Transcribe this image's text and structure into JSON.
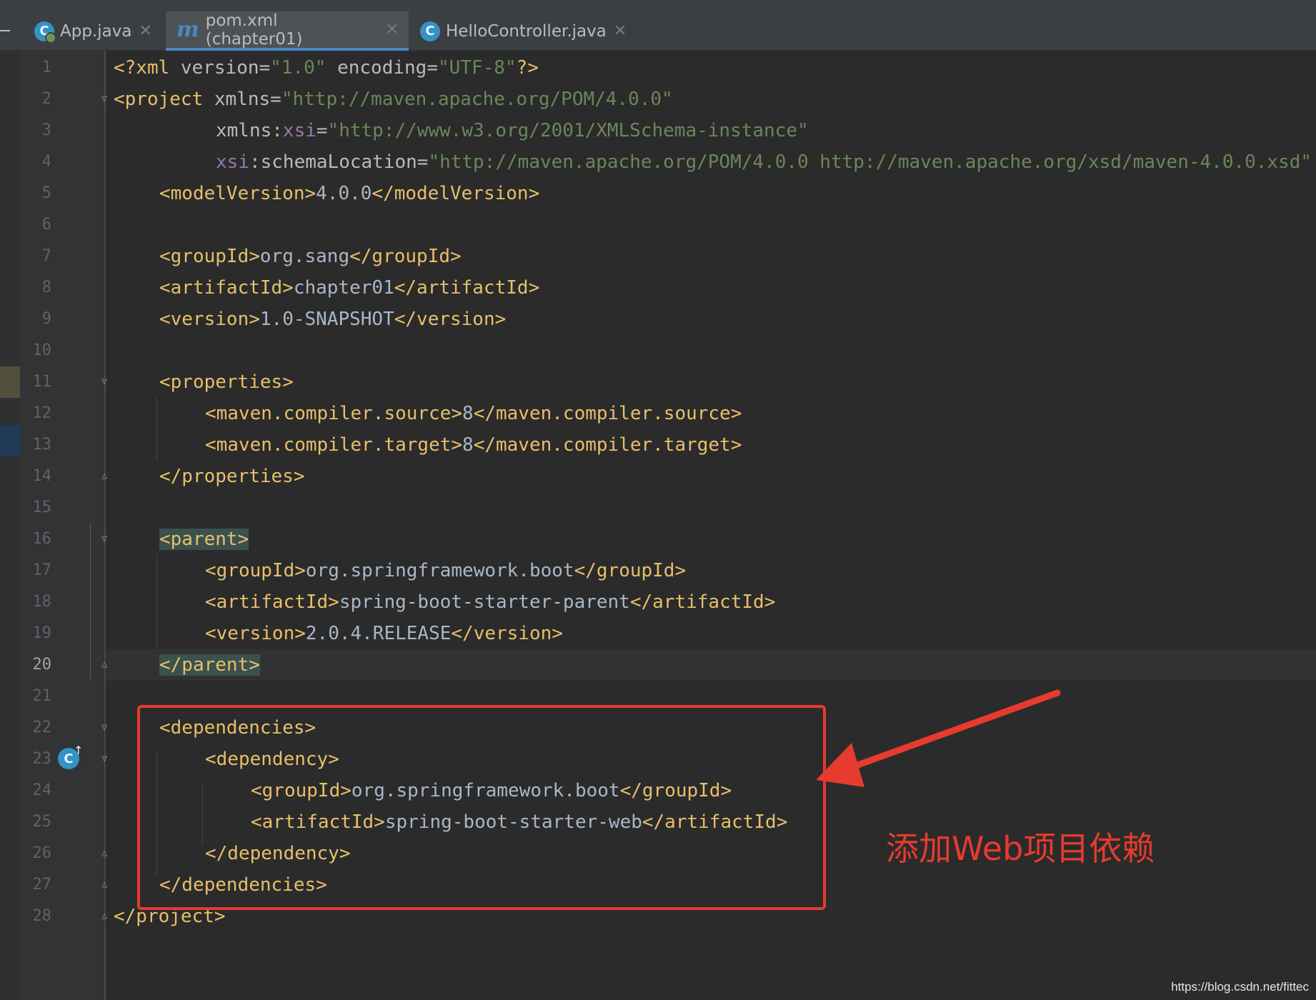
{
  "tabs": [
    {
      "label": "App.java",
      "icon": "spring-class-icon",
      "active": false
    },
    {
      "label": "pom.xml (chapter01)",
      "icon": "maven-icon",
      "active": true
    },
    {
      "label": "HelloController.java",
      "icon": "class-icon",
      "active": false
    }
  ],
  "tab_icon_glyphs": {
    "class": "C",
    "maven": "m"
  },
  "close_glyph": "✕",
  "code": {
    "line_numbers": [
      "1",
      "2",
      "3",
      "4",
      "5",
      "6",
      "7",
      "8",
      "9",
      "10",
      "11",
      "12",
      "13",
      "14",
      "15",
      "16",
      "17",
      "18",
      "19",
      "20",
      "21",
      "22",
      "23",
      "24",
      "25",
      "26",
      "27",
      "28"
    ],
    "current_line": "20",
    "l1": {
      "open": "<?xml ",
      "a1": "version",
      "eq": "=",
      "v1": "\"1.0\"",
      "sp": " ",
      "a2": "encoding",
      "v2": "\"UTF-8\"",
      "close": "?>"
    },
    "l2": {
      "open": "<project ",
      "a1": "xmlns",
      "eq": "=",
      "v1": "\"http://maven.apache.org/POM/4.0.0\""
    },
    "l3": {
      "ns_prefix": "xmlns:",
      "ns": "xsi",
      "eq": "=",
      "v1": "\"http://www.w3.org/2001/XMLSchema-instance\""
    },
    "l4": {
      "ns": "xsi",
      "attr": ":schemaLocation",
      "eq": "=",
      "v1": "\"http://maven.apache.org/POM/4.0.0 http://maven.apache.org/xsd/maven-4.0.0.xsd\""
    },
    "l5": {
      "open": "<modelVersion>",
      "text": "4.0.0",
      "close": "</modelVersion>"
    },
    "l7": {
      "open": "<groupId>",
      "text": "org.sang",
      "close": "</groupId>"
    },
    "l8": {
      "open": "<artifactId>",
      "text": "chapter01",
      "close": "</artifactId>"
    },
    "l9": {
      "open": "<version>",
      "text": "1.0-SNAPSHOT",
      "close": "</version>"
    },
    "l11": {
      "tag": "<properties>"
    },
    "l12": {
      "open": "<maven.compiler.source>",
      "text": "8",
      "close": "</maven.compiler.source>"
    },
    "l13": {
      "open": "<maven.compiler.target>",
      "text": "8",
      "close": "</maven.compiler.target>"
    },
    "l14": {
      "tag": "</properties>"
    },
    "l16": {
      "tag": "<parent>"
    },
    "l17": {
      "open": "<groupId>",
      "text": "org.springframework.boot",
      "close": "</groupId>"
    },
    "l18": {
      "open": "<artifactId>",
      "text": "spring-boot-starter-parent",
      "close": "</artifactId>"
    },
    "l19": {
      "open": "<version>",
      "text": "2.0.4.RELEASE",
      "close": "</version>"
    },
    "l20": {
      "tag": "</parent>"
    },
    "l22": {
      "tag": "<dependencies>"
    },
    "l23": {
      "tag": "<dependency>"
    },
    "l24": {
      "open": "<groupId>",
      "text": "org.springframework.boot",
      "close": "</groupId>"
    },
    "l25": {
      "open": "<artifactId>",
      "text": "spring-boot-starter-web",
      "close": "</artifactId>"
    },
    "l26": {
      "tag": "</dependency>"
    },
    "l27": {
      "tag": "</dependencies>"
    },
    "l28": {
      "tag": "</project>"
    }
  },
  "gutter_badge": {
    "glyph": "C",
    "arrow": "↑"
  },
  "annotation": {
    "text": "添加Web项目依赖",
    "color": "#e63b2e"
  },
  "watermark": "https://blog.csdn.net/fittec",
  "colors": {
    "editor_bg": "#2b2b2b",
    "tag": "#e8bf6a",
    "attribute": "#bababa",
    "namespace": "#9876aa",
    "string": "#6a8759",
    "text": "#a9b7c6",
    "tag_match_highlight": "#3b514d",
    "tab_underline": "#4a88c7"
  }
}
